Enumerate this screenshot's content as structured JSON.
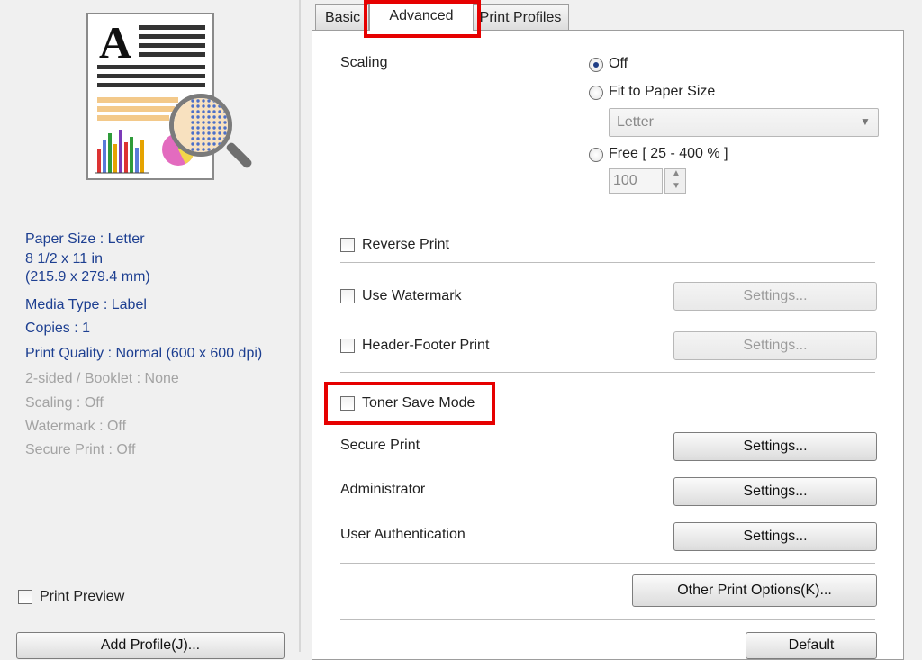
{
  "tabs": [
    {
      "label": "Basic"
    },
    {
      "label": "Advanced"
    },
    {
      "label": "Print Profiles"
    }
  ],
  "summary": {
    "paper_size": "Paper Size : Letter",
    "paper_dims_in": "8 1/2 x 11 in",
    "paper_dims_mm": "(215.9 x 279.4 mm)",
    "media_type": "Media Type : Label",
    "copies": "Copies : 1",
    "print_quality": "Print Quality : Normal (600 x 600 dpi)",
    "two_sided": "2-sided / Booklet : None",
    "scaling": "Scaling : Off",
    "watermark": "Watermark : Off",
    "secure_print": "Secure Print : Off"
  },
  "left_footer": {
    "print_preview_label": "Print Preview",
    "add_profile_label": "Add Profile(J)..."
  },
  "advanced": {
    "scaling_label": "Scaling",
    "scaling_off": "Off",
    "fit_to_paper": "Fit to Paper Size",
    "paper_select": "Letter",
    "free": "Free [ 25 - 400 % ]",
    "free_value": "100",
    "reverse_print": "Reverse Print",
    "use_watermark": "Use Watermark",
    "header_footer": "Header-Footer Print",
    "toner_save": "Toner Save Mode",
    "secure_print": "Secure Print",
    "administrator": "Administrator",
    "user_auth": "User Authentication",
    "settings": "Settings...",
    "other_options": "Other Print Options(K)...",
    "default": "Default"
  },
  "colors": {
    "highlight": "#e60000",
    "info_blue": "#1d3f91",
    "info_gray": "#a3a3a3"
  }
}
